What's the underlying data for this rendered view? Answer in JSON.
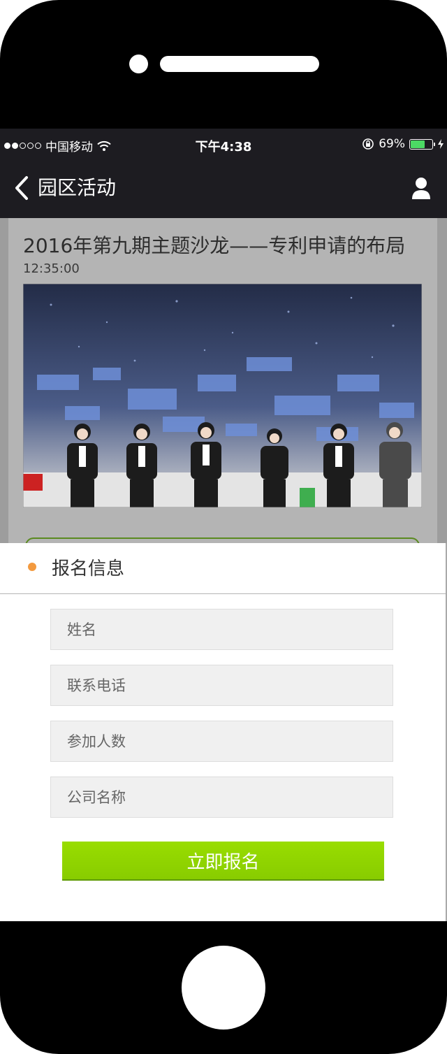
{
  "status_bar": {
    "carrier": "中国移动",
    "time": "下午4:38",
    "battery": "69%",
    "battery_level": 0.69,
    "signal_bars_filled": 2,
    "signal_bars_total": 5
  },
  "nav": {
    "title": "园区活动",
    "back_icon": "chevron-left-icon",
    "profile_icon": "user-icon"
  },
  "event": {
    "title": "2016年第九期主题沙龙——专利申请的布局",
    "time": "12:35:00"
  },
  "form": {
    "header": "报名信息",
    "fields": [
      {
        "placeholder": "姓名"
      },
      {
        "placeholder": "联系电话"
      },
      {
        "placeholder": "参加人数"
      },
      {
        "placeholder": "公司名称"
      }
    ],
    "submit_label": "立即报名"
  },
  "colors": {
    "nav_bg": "#1d1c21",
    "accent_orange": "#f39a3f",
    "submit_green": "#8fd400",
    "battery_green": "#4cd964"
  }
}
